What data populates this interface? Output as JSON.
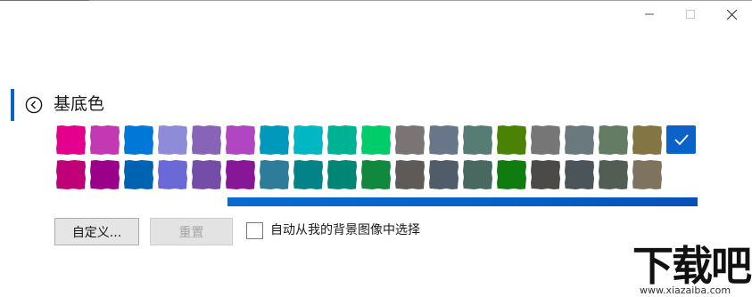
{
  "window": {
    "controls": {
      "minimize_icon": "minimize-icon",
      "maximize_icon": "maximize-icon",
      "close_icon": "close-icon"
    }
  },
  "header": {
    "back_icon": "back-arrow-circle-icon",
    "title": "基底色",
    "accent_color": "#0b63c9"
  },
  "swatches": {
    "row1": [
      "#e4008d",
      "#c239b3",
      "#0078d7",
      "#8e8cd8",
      "#8764b8",
      "#b146c2",
      "#0099bc",
      "#00b7c3",
      "#00b294",
      "#00cc6a",
      "#7a7574",
      "#68768a",
      "#567c73",
      "#498205",
      "#767676",
      "#69797e",
      "#647c64",
      "#847545"
    ],
    "row2": [
      "#bf0077",
      "#9a0089",
      "#0063b1",
      "#6b69d6",
      "#744da9",
      "#881798",
      "#2d7d9a",
      "#038387",
      "#018574",
      "#10893e",
      "#5d5a58",
      "#515c6b",
      "#486860",
      "#107c10",
      "#4c4a48",
      "#4a5459",
      "#525e54",
      "#7e735f"
    ],
    "selected_color": "#0b63c9",
    "selected_icon": "checkmark-icon"
  },
  "preview": {
    "color": "#0a6ad0"
  },
  "buttons": {
    "custom_label": "自定义...",
    "reset_label": "重置"
  },
  "auto_select": {
    "label": "自动从我的背景图像中选择",
    "checked": false
  },
  "watermark": {
    "brand": "下载吧",
    "url": "www.xiazaiba.com"
  }
}
